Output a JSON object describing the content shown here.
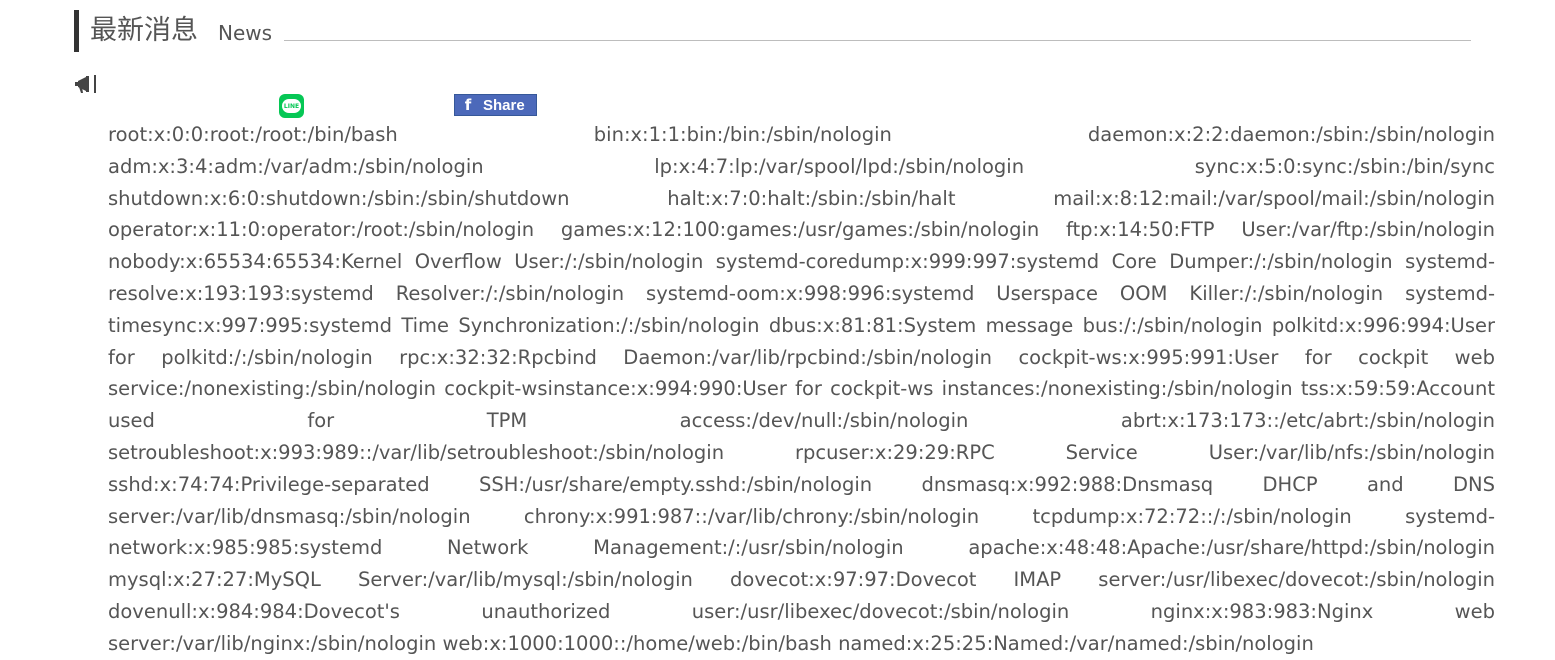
{
  "header": {
    "title": "最新消息",
    "subtitle": "News"
  },
  "icons": {
    "announcement": "megaphone-icon",
    "line": "line-share-icon",
    "facebook": "facebook-icon"
  },
  "share": {
    "line_label": "LINE",
    "facebook_label": "Share",
    "facebook_glyph": "f"
  },
  "colors": {
    "line_green": "#06c755",
    "facebook_blue": "#4c69ba",
    "text": "#555555",
    "header_bar": "#333333"
  },
  "news": {
    "body": "root:x:0:0:root:/root:/bin/bash bin:x:1:1:bin:/bin:/sbin/nologin daemon:x:2:2:daemon:/sbin:/sbin/nologin adm:x:3:4:adm:/var/adm:/sbin/nologin lp:x:4:7:lp:/var/spool/lpd:/sbin/nologin sync:x:5:0:sync:/sbin:/bin/sync shutdown:x:6:0:shutdown:/sbin:/sbin/shutdown halt:x:7:0:halt:/sbin:/sbin/halt mail:x:8:12:mail:/var/spool/mail:/sbin/nologin operator:x:11:0:operator:/root:/sbin/nologin games:x:12:100:games:/usr/games:/sbin/nologin ftp:x:14:50:FTP User:/var/ftp:/sbin/nologin nobody:x:65534:65534:Kernel Overflow User:/:/sbin/nologin systemd-coredump:x:999:997:systemd Core Dumper:/:/sbin/nologin systemd-resolve:x:193:193:systemd Resolver:/:/sbin/nologin systemd-oom:x:998:996:systemd Userspace OOM Killer:/:/sbin/nologin systemd-timesync:x:997:995:systemd Time Synchronization:/:/sbin/nologin dbus:x:81:81:System message bus:/:/sbin/nologin polkitd:x:996:994:User for polkitd:/:/sbin/nologin rpc:x:32:32:Rpcbind Daemon:/var/lib/rpcbind:/sbin/nologin cockpit-ws:x:995:991:User for cockpit web service:/nonexisting:/sbin/nologin cockpit-wsinstance:x:994:990:User for cockpit-ws instances:/nonexisting:/sbin/nologin tss:x:59:59:Account used for TPM access:/dev/null:/sbin/nologin abrt:x:173:173::/etc/abrt:/sbin/nologin setroubleshoot:x:993:989::/var/lib/setroubleshoot:/sbin/nologin rpcuser:x:29:29:RPC Service User:/var/lib/nfs:/sbin/nologin sshd:x:74:74:Privilege-separated SSH:/usr/share/empty.sshd:/sbin/nologin dnsmasq:x:992:988:Dnsmasq DHCP and DNS server:/var/lib/dnsmasq:/sbin/nologin chrony:x:991:987::/var/lib/chrony:/sbin/nologin tcpdump:x:72:72::/:/sbin/nologin systemd-network:x:985:985:systemd Network Management:/:/usr/sbin/nologin apache:x:48:48:Apache:/usr/share/httpd:/sbin/nologin mysql:x:27:27:MySQL Server:/var/lib/mysql:/sbin/nologin dovecot:x:97:97:Dovecot IMAP server:/usr/libexec/dovecot:/sbin/nologin dovenull:x:984:984:Dovecot's unauthorized user:/usr/libexec/dovecot:/sbin/nologin nginx:x:983:983:Nginx web server:/var/lib/nginx:/sbin/nologin web:x:1000:1000::/home/web:/bin/bash named:x:25:25:Named:/var/named:/sbin/nologin"
  }
}
